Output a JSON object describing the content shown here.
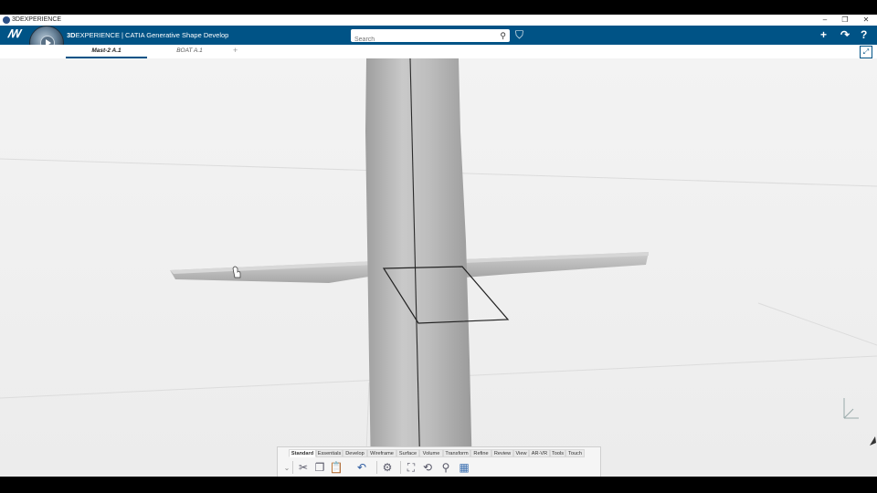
{
  "window": {
    "title": "3DEXPERIENCE",
    "controls": {
      "minimize": "–",
      "restore": "❐",
      "close": "✕"
    }
  },
  "header": {
    "brand_bold": "3D",
    "brand_rest": "EXPERIENCE | CATIA",
    "app_name": "Generative Shape Develop",
    "search_placeholder": "Search",
    "icons": [
      "3ds-logo-icon",
      "compass-icon",
      "search-icon",
      "tag-icon",
      "add-icon",
      "share-icon",
      "help-icon"
    ],
    "accent_color": "#005386"
  },
  "tabs": [
    {
      "label": "Mast-2 A.1",
      "active": true
    },
    {
      "label": "BOAT A.1",
      "active": false
    }
  ],
  "tab_add": "+",
  "toolbar": {
    "tabs": [
      "Standard",
      "Essentials",
      "Develop",
      "Wireframe",
      "Surface",
      "Volume",
      "Transform",
      "Refine",
      "Review",
      "View",
      "AR-VR",
      "Tools",
      "Touch"
    ],
    "active_tab": "Standard",
    "icons": [
      "cut-icon",
      "copy-icon",
      "paste-icon",
      "undo-icon",
      "settings-icon",
      "pan-icon",
      "rotate-icon",
      "zoom-icon",
      "render-icon"
    ]
  }
}
